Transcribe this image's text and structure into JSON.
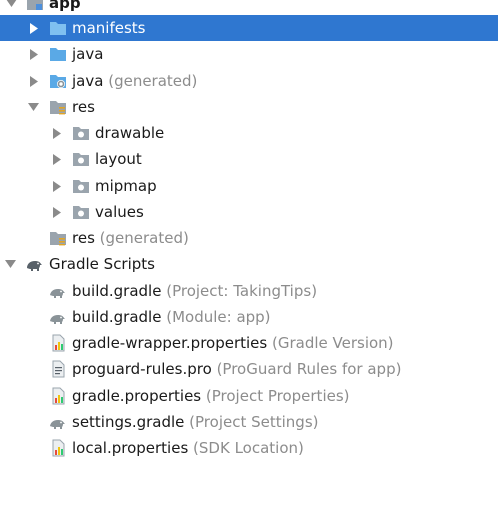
{
  "tree": {
    "app": {
      "label": "app"
    },
    "manifests": {
      "label": "manifests"
    },
    "java": {
      "label": "java"
    },
    "java_generated": {
      "label": "java",
      "suffix": "(generated)"
    },
    "res": {
      "label": "res"
    },
    "drawable": {
      "label": "drawable"
    },
    "layout": {
      "label": "layout"
    },
    "mipmap": {
      "label": "mipmap"
    },
    "values": {
      "label": "values"
    },
    "res_generated": {
      "label": "res",
      "suffix": "(generated)"
    },
    "gradle_scripts": {
      "label": "Gradle Scripts"
    },
    "build_gradle_project": {
      "label": "build.gradle",
      "suffix": "(Project: TakingTips)"
    },
    "build_gradle_module": {
      "label": "build.gradle",
      "suffix": "(Module: app)"
    },
    "gradle_wrapper": {
      "label": "gradle-wrapper.properties",
      "suffix": "(Gradle Version)"
    },
    "proguard": {
      "label": "proguard-rules.pro",
      "suffix": "(ProGuard Rules for app)"
    },
    "gradle_properties": {
      "label": "gradle.properties",
      "suffix": "(Project Properties)"
    },
    "settings_gradle": {
      "label": "settings.gradle",
      "suffix": "(Project Settings)"
    },
    "local_properties": {
      "label": "local.properties",
      "suffix": "(SDK Location)"
    }
  },
  "colors": {
    "selection": "#2f77d0",
    "folder": "#5aa9e6",
    "dim_text": "#8c8c8c",
    "gradle_gray": "#8a9398"
  }
}
